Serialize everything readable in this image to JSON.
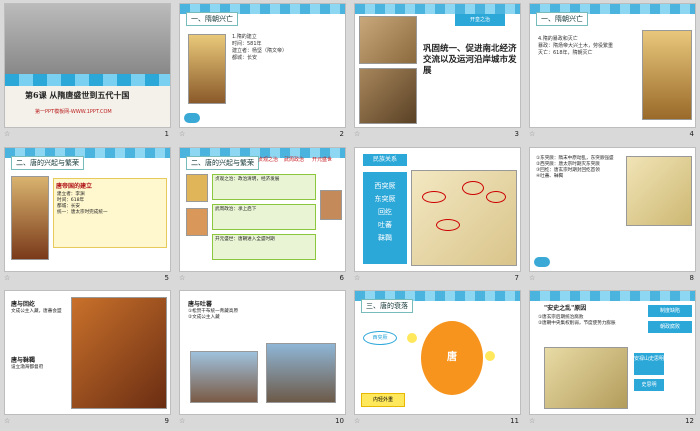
{
  "slides": [
    {
      "num": "1",
      "title": "第6课  从隋唐盛世到五代十国",
      "subtitle": "第一PPT模板网-WWW.1PPT.COM"
    },
    {
      "num": "2",
      "header": "一、隋朝兴亡",
      "lines": [
        "1.隋的建立",
        "时间：581年",
        "建立者：杨坚（隋文帝）",
        "都城：长安"
      ]
    },
    {
      "num": "3",
      "tag": "开皇之治",
      "text": "巩固统一、促进南北经济交流以及运河沿岸城市发展"
    },
    {
      "num": "4",
      "header": "一、隋朝兴亡",
      "lines": [
        "4.隋的暴政和灭亡",
        "暴政：隋炀帝大兴土木，劳役繁重",
        "灭亡：618年，隋朝灭亡"
      ]
    },
    {
      "num": "5",
      "header": "二、唐的兴起与繁荣",
      "box_title": "唐帝国的建立",
      "lines": [
        "建立者：李渊",
        "时间：618年",
        "都城：长安",
        "统一：唐太宗时完成统一"
      ]
    },
    {
      "num": "6",
      "header": "二、唐的兴起与繁荣",
      "tags": [
        "贞观之治",
        "武周政治",
        "开元盛世"
      ],
      "rows": [
        "贞观之治：政治清明，经济发展",
        "武周政治：承上启下",
        "开元盛世：唐朝进入全盛时期"
      ]
    },
    {
      "num": "7",
      "header": "民族关系",
      "names": [
        "西突厥",
        "东突厥",
        "回纥",
        "吐蕃",
        "靺鞨"
      ]
    },
    {
      "num": "8",
      "lines": [
        "①东突厥：隋末中原动乱，东突厥强盛",
        "②西突厥：唐太宗时期灭东突厥",
        "③回纥：唐玄宗时期封回纥首领",
        "④吐蕃、靺鞨"
      ]
    },
    {
      "num": "9",
      "title1": "唐与回纥",
      "text1": "文成公主入藏，唐蕃会盟",
      "title2": "唐与靺鞨",
      "text2": "设立渤海都督府"
    },
    {
      "num": "10",
      "title": "唐与吐蕃",
      "lines": [
        "①松赞干布统一青藏高原",
        "②文成公主入藏"
      ]
    },
    {
      "num": "11",
      "header": "三、唐的衰落",
      "west": "西突厥",
      "center": "唐",
      "bottom": "内轻外重"
    },
    {
      "num": "12",
      "title": "\"安史之乱\"原因",
      "lines": [
        "①唐玄宗后期统治腐败",
        "②唐朝中央集权削弱，节度使势力膨胀"
      ],
      "tags": [
        "制度缺陷",
        "朝政腐败",
        "安禄山史思明",
        "史思明"
      ]
    }
  ],
  "colors": {
    "sky": "#2ba7d8",
    "green": "#8cc63f",
    "orange": "#f7941d",
    "yellow": "#ffe85c",
    "red": "#c4161c"
  }
}
